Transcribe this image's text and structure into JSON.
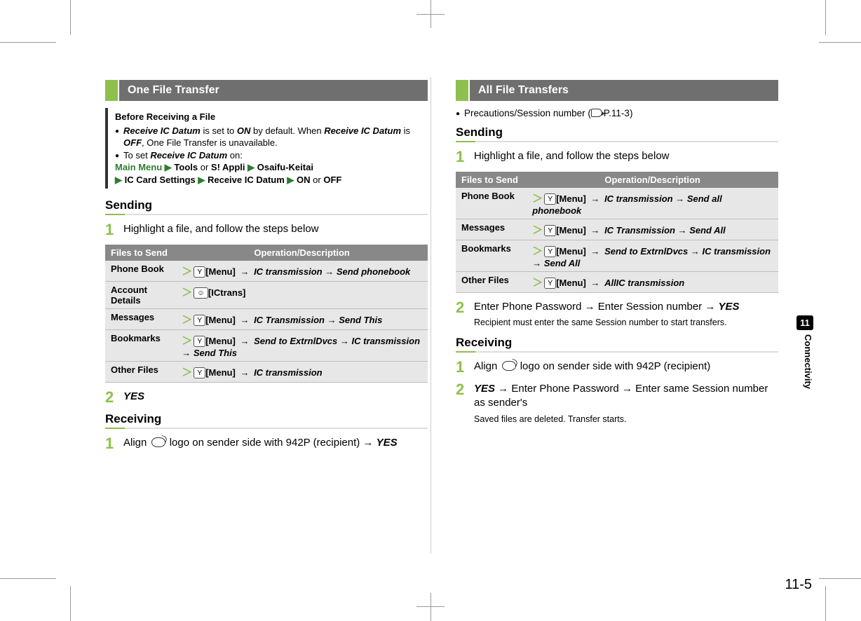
{
  "chapter": {
    "number": "11",
    "title": "Connectivity"
  },
  "page_number": "11-5",
  "left": {
    "heading": "One File Transfer",
    "note": {
      "title": "Before Receiving a File",
      "line1a": "Receive IC Datum",
      "line1b": " is set to ",
      "line1c": "ON",
      "line1d": " by default. When ",
      "line2a": "Receive IC Datum",
      "line2b": " is ",
      "line2c": "OFF",
      "line2d": ", One File Transfer is unavailable.",
      "line3a": "To set ",
      "line3b": "Receive IC Datum",
      "line3c": " on:",
      "path": {
        "p1": "Main Menu",
        "p2": "Tools",
        "or1": " or ",
        "p3": "S! Appli",
        "p4": "Osaifu-Keitai",
        "p5": "IC Card Settings",
        "p6": "Receive IC Datum",
        "p7": "ON",
        "or2": " or ",
        "p8": "OFF"
      }
    },
    "sending": {
      "title": "Sending",
      "step1": "Highlight a file, and follow the steps below",
      "table": {
        "h1": "Files to Send",
        "h2": "Operation/Description",
        "rows": [
          {
            "label": "Phone Book",
            "key": "Y",
            "keylabel": "[Menu]",
            "rest": [
              {
                "t": "IC transmission",
                "c": "bi"
              },
              {
                "t": " → ",
                "c": ""
              },
              {
                "t": "Send phonebook",
                "c": "bi"
              }
            ]
          },
          {
            "label": "Account Details",
            "key": "☺",
            "keylabel": "[ICtrans]",
            "rest": []
          },
          {
            "label": "Messages",
            "key": "Y",
            "keylabel": "[Menu]",
            "rest": [
              {
                "t": "IC Transmission",
                "c": "bi"
              },
              {
                "t": " → ",
                "c": ""
              },
              {
                "t": "Send This",
                "c": "bi"
              }
            ]
          },
          {
            "label": "Bookmarks",
            "key": "Y",
            "keylabel": "[Menu]",
            "rest": [
              {
                "t": "Send to ExtrnlDvcs",
                "c": "bi"
              },
              {
                "t": " → ",
                "c": ""
              },
              {
                "t": "IC transmission",
                "c": "bi"
              },
              {
                "t": " → ",
                "c": ""
              },
              {
                "t": "Send This",
                "c": "bi"
              }
            ]
          },
          {
            "label": "Other Files",
            "key": "Y",
            "keylabel": "[Menu]",
            "rest": [
              {
                "t": "IC transmission",
                "c": "bi"
              }
            ]
          }
        ]
      },
      "step2": "YES"
    },
    "receiving": {
      "title": "Receiving",
      "step1a": "Align ",
      "step1b": " logo on sender side with 942P (recipient) → ",
      "step1c": "YES"
    }
  },
  "right": {
    "heading": "All File Transfers",
    "precaution": "Precautions/Session number (",
    "precaution_ref": "P.11-3",
    "precaution_close": ")",
    "sending": {
      "title": "Sending",
      "step1": "Highlight a file, and follow the steps below",
      "table": {
        "h1": "Files to Send",
        "h2": "Operation/Description",
        "rows": [
          {
            "label": "Phone Book",
            "key": "Y",
            "keylabel": "[Menu]",
            "rest": [
              {
                "t": "IC transmission",
                "c": "bi"
              },
              {
                "t": " → ",
                "c": ""
              },
              {
                "t": "Send all phonebook",
                "c": "bi"
              }
            ]
          },
          {
            "label": "Messages",
            "key": "Y",
            "keylabel": "[Menu]",
            "rest": [
              {
                "t": "IC Transmission",
                "c": "bi"
              },
              {
                "t": " → ",
                "c": ""
              },
              {
                "t": "Send All",
                "c": "bi"
              }
            ]
          },
          {
            "label": "Bookmarks",
            "key": "Y",
            "keylabel": "[Menu]",
            "rest": [
              {
                "t": "Send to ExtrnlDvcs",
                "c": "bi"
              },
              {
                "t": " → ",
                "c": ""
              },
              {
                "t": "IC transmission",
                "c": "bi"
              },
              {
                "t": " → ",
                "c": ""
              },
              {
                "t": "Send All",
                "c": "bi"
              }
            ]
          },
          {
            "label": "Other Files",
            "key": "Y",
            "keylabel": "[Menu]",
            "rest": [
              {
                "t": "AllIC transmission",
                "c": "bi"
              }
            ]
          }
        ]
      },
      "step2": "Enter Phone Password → Enter Session number → ",
      "step2b": "YES",
      "step2sub": "Recipient must enter the same Session number to start transfers."
    },
    "receiving": {
      "title": "Receiving",
      "step1a": "Align ",
      "step1b": " logo on sender side with 942P (recipient)",
      "step2a": "YES",
      "step2b": " → Enter Phone Password → Enter same Session number as sender's",
      "step2sub": "Saved files are deleted. Transfer starts."
    }
  }
}
